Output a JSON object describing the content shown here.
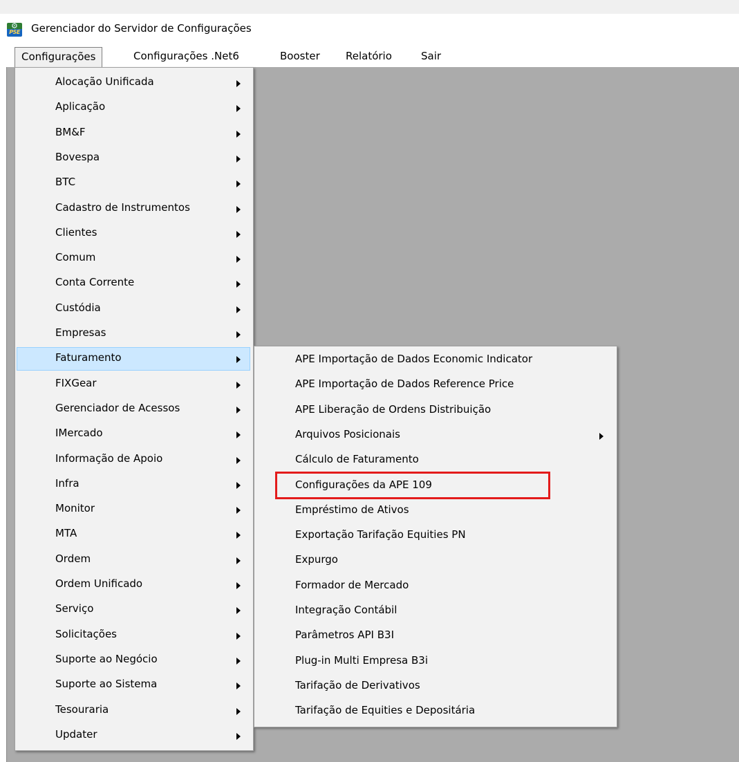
{
  "window": {
    "title": "Gerenciador do Servidor de Configurações"
  },
  "menubar": {
    "items": [
      "Configurações",
      "Configurações .Net6",
      "Booster",
      "Relatório",
      "Sair"
    ]
  },
  "menu_configuracoes": {
    "items": [
      "Alocação Unificada",
      "Aplicação",
      "BM&F",
      "Bovespa",
      "BTC",
      "Cadastro de Instrumentos",
      "Clientes",
      "Comum",
      "Conta Corrente",
      "Custódia",
      "Empresas",
      "Faturamento",
      "FIXGear",
      "Gerenciador de Acessos",
      "IMercado",
      "Informação de Apoio",
      "Infra",
      "Monitor",
      "MTA",
      "Ordem",
      "Ordem Unificado",
      "Serviço",
      "Solicitações",
      "Suporte ao Negócio",
      "Suporte ao Sistema",
      "Tesouraria",
      "Updater"
    ],
    "highlighted": "Faturamento"
  },
  "menu_faturamento": {
    "items": [
      "APE Importação de Dados Economic Indicator",
      "APE Importação de Dados Reference Price",
      "APE Liberação de Ordens Distribuição",
      "Arquivos Posicionais",
      "Cálculo de Faturamento",
      "Configurações da APE 109",
      "Empréstimo de Ativos",
      "Exportação Tarifação Equities PN",
      "Expurgo",
      "Formador de Mercado",
      "Integração Contábil",
      "Parâmetros API B3I",
      "Plug-in Multi Empresa B3i",
      "Tarifação de Derivativos",
      "Tarifação de Equities e Depositária"
    ],
    "has_submenu": [
      "Arquivos Posicionais"
    ],
    "annotated_item": "Configurações da APE 109",
    "annotation_color": "#e31b1b"
  },
  "colors": {
    "highlight": "#cce8ff",
    "highlight_border": "#99d1ff",
    "client_bg": "#ababab"
  }
}
